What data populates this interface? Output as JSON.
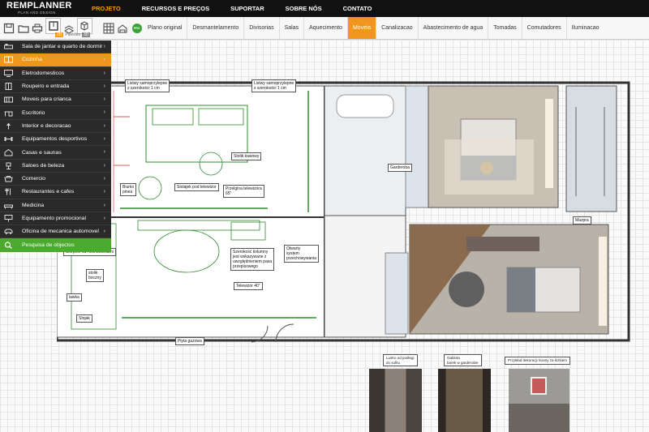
{
  "logo": {
    "name_rem": "REM",
    "name_planner": "PLANNER",
    "tagline": "PLAN AND DESIGN"
  },
  "nav": [
    "PROJETO",
    "RECURSOS E PREÇOS",
    "SUPORTAR",
    "SOBRE NÓS",
    "CONTATO"
  ],
  "view_toggle": {
    "mode_2d": "2D",
    "label": "Paredes",
    "mode_3d": "3D"
  },
  "tool_badge": "PRO",
  "tabs": [
    "Plano original",
    "Desmantelamento",
    "Divisorias",
    "Salas",
    "Aquecimento",
    "Moveis",
    "Canalizacao",
    "Abastecimento de agua",
    "Tomadas",
    "Comutadores",
    "Iluminacao"
  ],
  "active_tab": "Moveis",
  "sidebar": {
    "items": [
      "Sala de jantar e quarto de dormir",
      "Cozinha",
      "Eletrodomesticos",
      "Roupeiro e entrada",
      "Moveis para crianca",
      "Escritorio",
      "Interior e decoracao",
      "Equipamentos desportivos",
      "Casas e saunas",
      "Saloes de beleza",
      "Comercio",
      "Restaurantes e cafes",
      "Medicina",
      "Equipamento promocional",
      "Oficina de mecanica automovel"
    ],
    "active": "Cozinha",
    "search_label": "Pesquisa de objectos"
  },
  "plan_labels": {
    "l1": "Listwy samoprzylepne\nz szerokości 1 cm",
    "l2": "Listwy samoprzylepne\nz szerokości 1 cm",
    "l3": "Stolik kawowy",
    "l4": "Przelgina telewizora\n65\"",
    "l5": "Stolajek pod telewizor",
    "l6": "Biurko\npinea",
    "l7": "Szerokość kolumny\njest wskazywane z\nuwzględnieniem pasa\nprzepisowego",
    "l8": "Otwarty\nsystem\nprzechowywania",
    "l9": "Telewizor 40\"",
    "l10": "stolik\nboczny",
    "l11": "lawka",
    "l12": "Stojak",
    "l13": "Płyta gazowa",
    "l14": "Garderoba",
    "l15": "Sierpnie na l'lecnowsniami",
    "l16": "Mazpra"
  },
  "references": [
    {
      "label": "Lustro od podłogi\ndo sufitu"
    },
    {
      "label": "Gablota\nbarek w garderobie"
    },
    {
      "label": "Przykład dekoracji ściany za łóżkiem"
    }
  ],
  "colors": {
    "accent": "#f0961c",
    "sidebar_bg": "#2a2a2a",
    "search_bg": "#4caa2e",
    "nav_bg": "#111111"
  }
}
